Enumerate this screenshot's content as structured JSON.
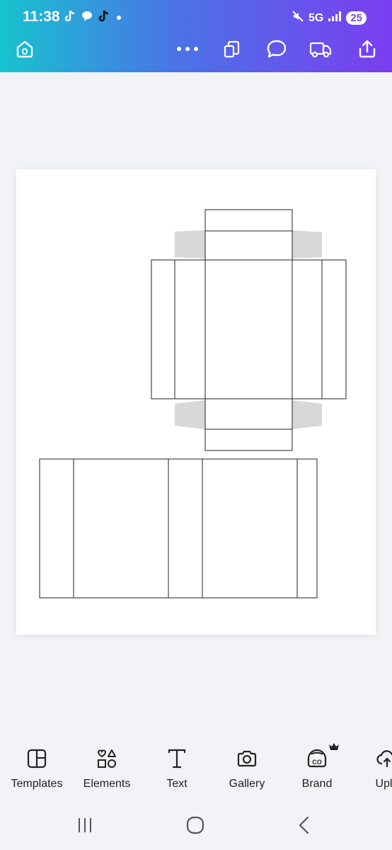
{
  "status_bar": {
    "time": "11:38",
    "network": "5G",
    "battery": "25"
  },
  "toolbar": {
    "icons": [
      "home-icon",
      "more-icon",
      "copy-pages-icon",
      "comment-icon",
      "delivery-truck-icon",
      "share-upload-icon"
    ]
  },
  "bottom_tools": [
    {
      "label": "Templates",
      "icon": "templates-icon"
    },
    {
      "label": "Elements",
      "icon": "elements-icon"
    },
    {
      "label": "Text",
      "icon": "text-icon"
    },
    {
      "label": "Gallery",
      "icon": "camera-icon"
    },
    {
      "label": "Brand",
      "icon": "brand-icon"
    },
    {
      "label": "Uplo",
      "icon": "upload-icon"
    }
  ],
  "nav": [
    "recent-apps-icon",
    "home-circle-icon",
    "back-icon"
  ],
  "colors": {
    "gradient_start": "#17c3cf",
    "gradient_end": "#7b3df0",
    "flap_gray": "#d8d8d8"
  }
}
